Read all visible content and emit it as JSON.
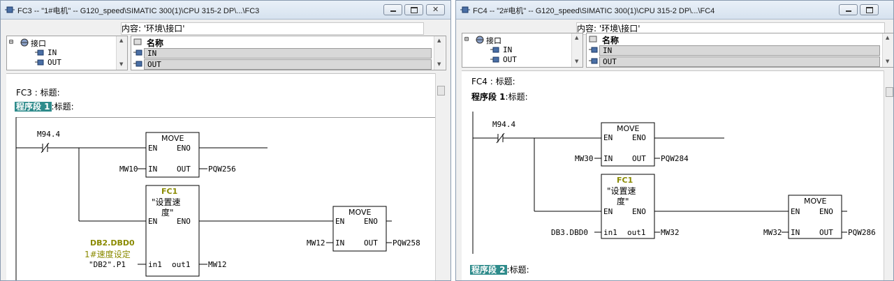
{
  "left_window": {
    "title": "FC3 -- \"1#电机\" -- G120_speed\\SIMATIC 300(1)\\CPU 315-2 DP\\...\\FC3",
    "content_label": "内容:  '环境\\接口'",
    "tree": {
      "root": "接口",
      "items": [
        "IN",
        "OUT"
      ]
    },
    "table": {
      "header": "名称",
      "rows": [
        "IN",
        "OUT"
      ]
    },
    "block_header": "FC3 : 标题:",
    "network1": {
      "label": "程序段 1",
      "title": ":标题:"
    },
    "contact": "M94.4",
    "move1": {
      "name": "MOVE",
      "en": "EN",
      "eno": "ENO",
      "in": "IN",
      "out": "OUT",
      "in_val": "MW10",
      "out_val": "PQW256"
    },
    "fc1": {
      "name": "FC1",
      "desc_line1": "\"设置速",
      "desc_line2": "度\"",
      "en": "EN",
      "eno": "ENO",
      "in": "in1",
      "out": "out1",
      "in_addr": "DB2.DBD0",
      "in_comment": "1#速度设定",
      "in_symbol": "\"DB2\".P1",
      "out_val": "MW12"
    },
    "move2": {
      "name": "MOVE",
      "en": "EN",
      "eno": "ENO",
      "in": "IN",
      "out": "OUT",
      "in_val": "MW12",
      "out_val": "PQW258"
    }
  },
  "right_window": {
    "title": "FC4 -- \"2#电机\" -- G120_speed\\SIMATIC 300(1)\\CPU 315-2 DP\\...\\FC4",
    "content_label": "内容:  '环境\\接口'",
    "tree": {
      "root": "接口",
      "items": [
        "IN",
        "OUT"
      ]
    },
    "table": {
      "header": "名称",
      "rows": [
        "IN",
        "OUT"
      ]
    },
    "block_header": "FC4 : 标题:",
    "network1": {
      "label": "程序段 1",
      "title": ":标题:"
    },
    "contact": "M94.4",
    "move1": {
      "name": "MOVE",
      "en": "EN",
      "eno": "ENO",
      "in": "IN",
      "out": "OUT",
      "in_val": "MW30",
      "out_val": "PQW284"
    },
    "fc1": {
      "name": "FC1",
      "desc_line1": "\"设置速",
      "desc_line2": "度\"",
      "en": "EN",
      "eno": "ENO",
      "in": "in1",
      "out": "out1",
      "in_addr": "DB3.DBD0",
      "out_val": "MW32"
    },
    "move2": {
      "name": "MOVE",
      "en": "EN",
      "eno": "ENO",
      "in": "IN",
      "out": "OUT",
      "in_val": "MW32",
      "out_val": "PQW286"
    },
    "network2": {
      "label": "程序段 2",
      "title": ":标题:"
    }
  },
  "colors": {
    "network_highlight": "#2e8b8b",
    "fc_name": "#8a8a00"
  }
}
